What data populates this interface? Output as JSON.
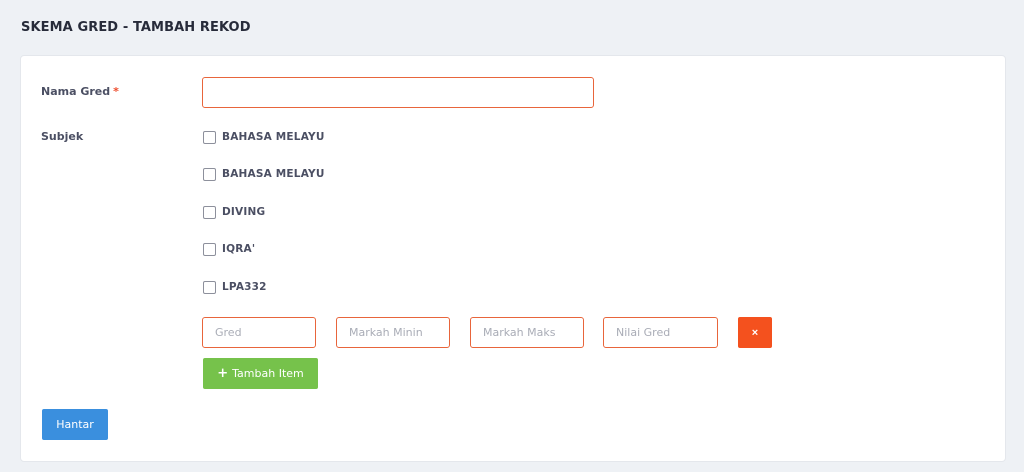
{
  "page": {
    "title": "SKEMA GRED - TAMBAH REKOD"
  },
  "form": {
    "nama_gred": {
      "label": "Nama Gred",
      "required_mark": "*",
      "value": ""
    },
    "subjek": {
      "label": "Subjek",
      "options": [
        {
          "label": "BAHASA MELAYU",
          "checked": false
        },
        {
          "label": "BAHASA MELAYU",
          "checked": false
        },
        {
          "label": "DIVING",
          "checked": false
        },
        {
          "label": "IQRA'",
          "checked": false
        },
        {
          "label": "LPA332",
          "checked": false
        }
      ]
    },
    "item": {
      "gred_placeholder": "Gred",
      "markah_min_placeholder": "Markah Minin",
      "markah_maks_placeholder": "Markah Maks",
      "nilai_gred_placeholder": "Nilai Gred",
      "remove_label": "×"
    },
    "add_item_label": "Tambah Item",
    "add_item_icon": "+",
    "submit_label": "Hantar"
  },
  "colors": {
    "input_border": "#e8653b",
    "remove_button": "#f4511e",
    "add_button": "#76c24b",
    "submit_button": "#3a8fde"
  }
}
